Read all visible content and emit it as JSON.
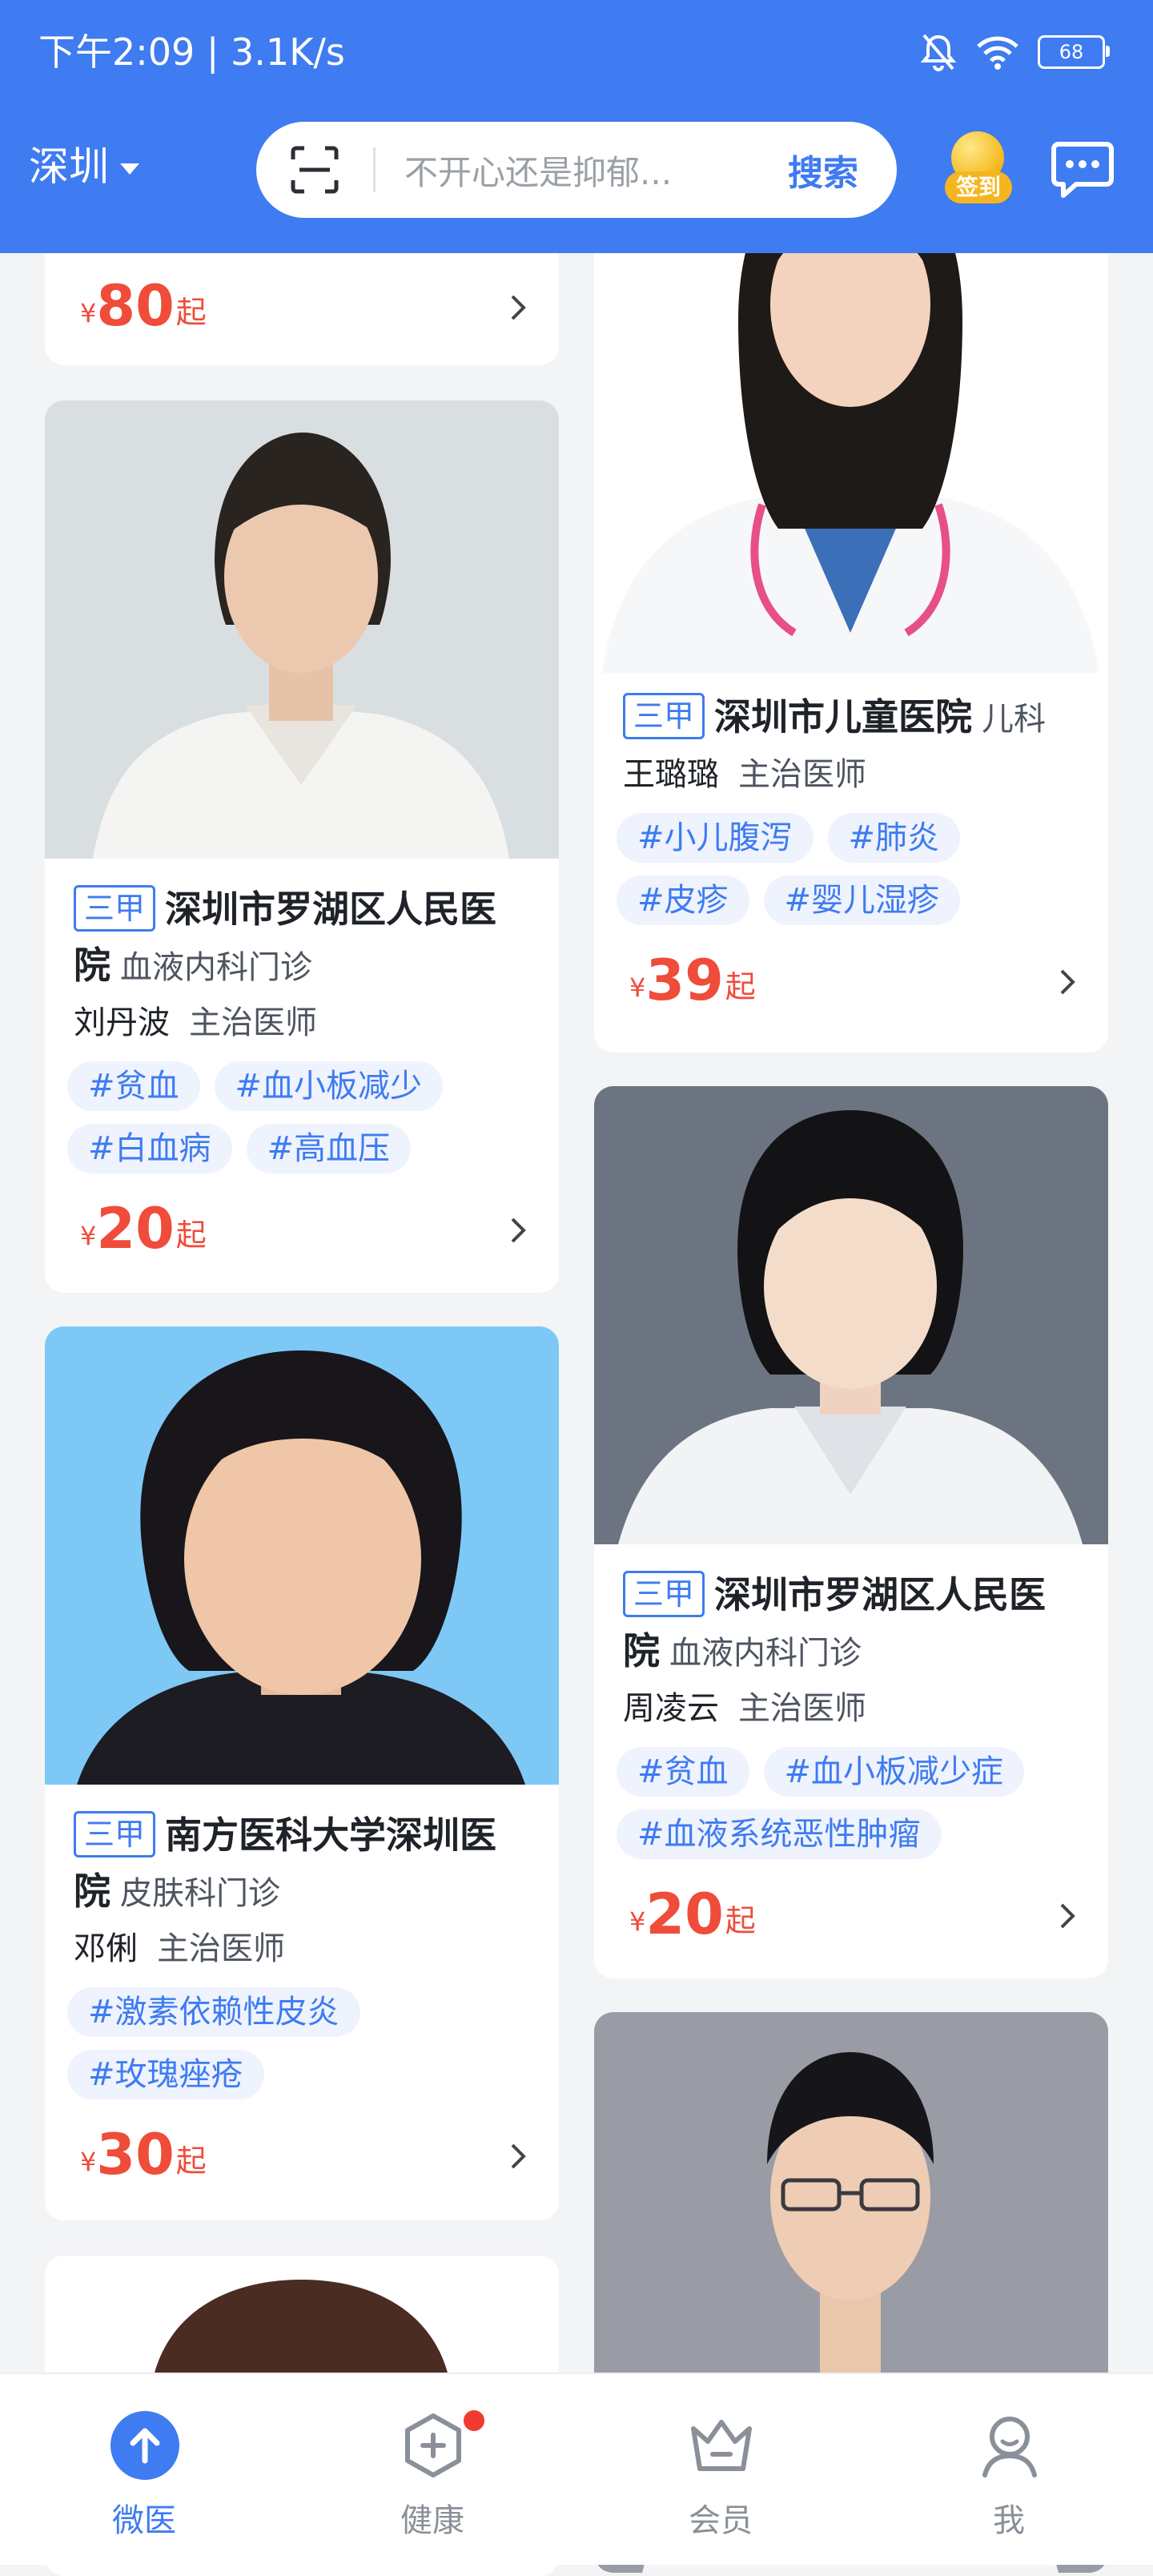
{
  "status_bar": {
    "time": "下午2:09 | 3.1K/s",
    "battery": "68"
  },
  "header": {
    "city": "深圳",
    "search_placeholder": "不开心还是抑郁...",
    "search_button": "搜索",
    "signin_label": "签到"
  },
  "feed": {
    "left": [
      {
        "price_yen": "¥",
        "price": "80",
        "price_suffix": "起"
      },
      {
        "tier": "三甲",
        "hospital": "深圳市罗湖区人民医院",
        "department": "血液内科门诊",
        "doctor": "刘丹波",
        "title": "主治医师",
        "tags": [
          "#贫血",
          "#血小板减少",
          "#白血病",
          "#高血压"
        ],
        "price_yen": "¥",
        "price": "20",
        "price_suffix": "起"
      },
      {
        "tier": "三甲",
        "hospital": "南方医科大学深圳医院",
        "department": "皮肤科门诊",
        "doctor": "邓俐",
        "title": "主治医师",
        "tags": [
          "#激素依赖性皮炎",
          "#玫瑰痤疮"
        ],
        "price_yen": "¥",
        "price": "30",
        "price_suffix": "起"
      }
    ],
    "right": [
      {
        "tier": "三甲",
        "hospital": "深圳市儿童医院",
        "department": "儿科",
        "doctor": "王璐璐",
        "title": "主治医师",
        "tags": [
          "#小儿腹泻",
          "#肺炎",
          "#皮疹",
          "#婴儿湿疹"
        ],
        "price_yen": "¥",
        "price": "39",
        "price_suffix": "起"
      },
      {
        "tier": "三甲",
        "hospital": "深圳市罗湖区人民医院",
        "department": "血液内科门诊",
        "doctor": "周凌云",
        "title": "主治医师",
        "tags": [
          "#贫血",
          "#血小板减少症",
          "#血液系统恶性肿瘤"
        ],
        "price_yen": "¥",
        "price": "20",
        "price_suffix": "起"
      }
    ]
  },
  "tabbar": [
    {
      "label": "微医",
      "icon": "upload-circle-icon"
    },
    {
      "label": "健康",
      "icon": "health-shield-icon"
    },
    {
      "label": "会员",
      "icon": "crown-icon"
    },
    {
      "label": "我",
      "icon": "user-icon"
    }
  ],
  "colors": {
    "brand_blue": "#3f7bf1",
    "price_red": "#ef4c3a",
    "background": "#f3f4f6"
  }
}
